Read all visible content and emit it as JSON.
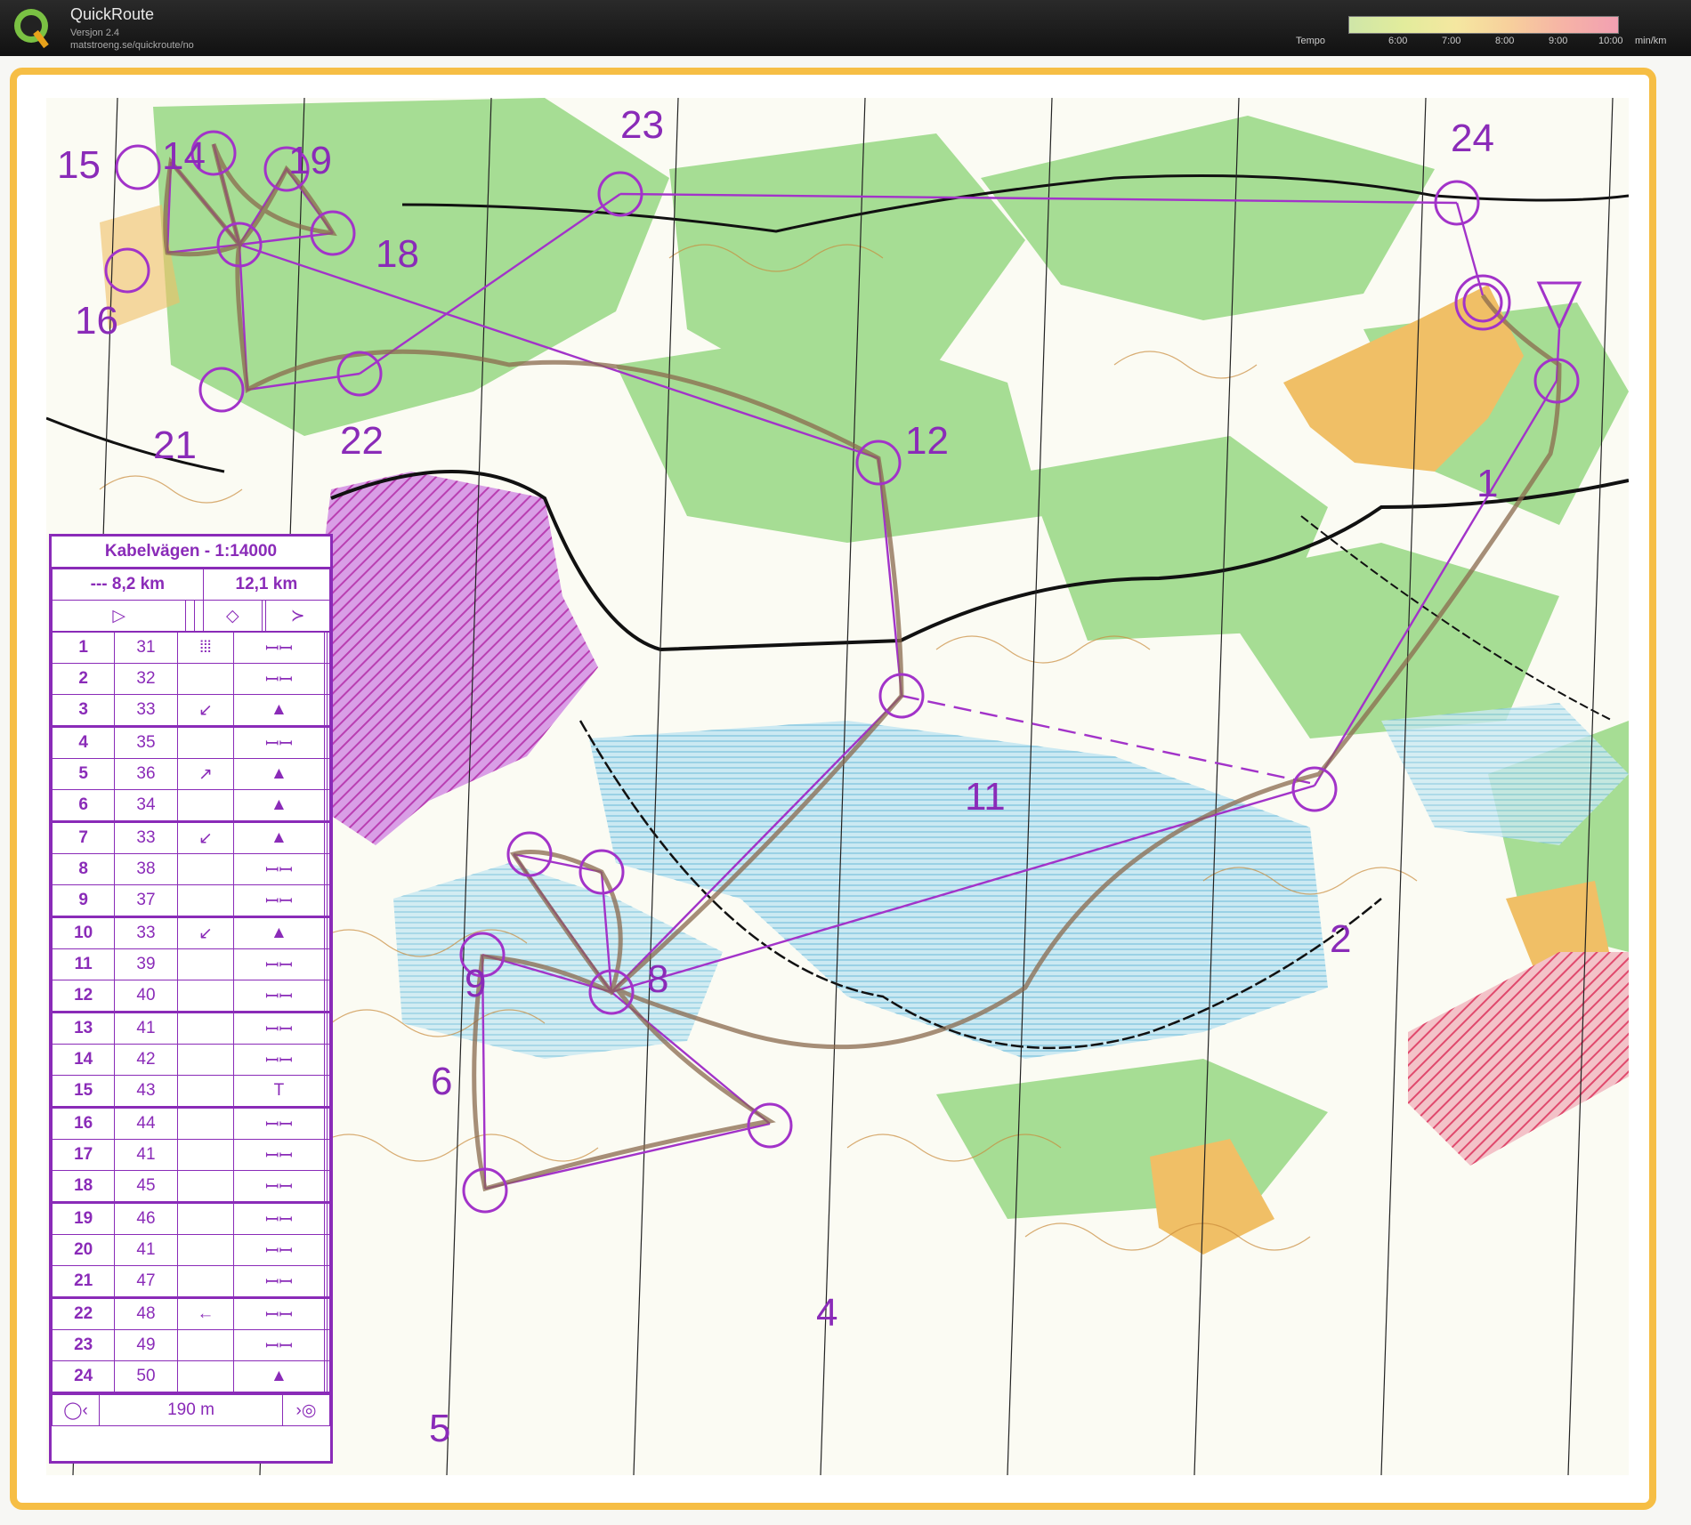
{
  "app": {
    "name": "QuickRoute",
    "version": "Versjon 2.4",
    "url": "matstroeng.se/quickroute/no"
  },
  "pace_legend": {
    "title": "Tempo",
    "unit": "min/km",
    "ticks": [
      "6:00",
      "7:00",
      "8:00",
      "9:00",
      "10:00"
    ]
  },
  "colors": {
    "course": "#a233c9",
    "frame": "#f6be45",
    "water": "#bfe3ec",
    "forest_green": "#9bd889",
    "open_land": "#f0bf66",
    "restricted": "#c86fd8"
  },
  "course": {
    "title": "Kabelvägen - 1:14000",
    "distance_short": "--- 8,2 km",
    "distance_long": "12,1 km",
    "finish_distance": "190 m",
    "rows": [
      {
        "n": "1",
        "code": "31",
        "c": "⦙⦙⦙",
        "d": "ꟷꟷ"
      },
      {
        "n": "2",
        "code": "32",
        "c": "",
        "d": "ꟷꟷ"
      },
      {
        "n": "3",
        "code": "33",
        "c": "↙",
        "d": "▲"
      },
      {
        "n": "4",
        "code": "35",
        "c": "",
        "d": "ꟷꟷ"
      },
      {
        "n": "5",
        "code": "36",
        "c": "↗",
        "d": "▲"
      },
      {
        "n": "6",
        "code": "34",
        "c": "",
        "d": "▲"
      },
      {
        "n": "7",
        "code": "33",
        "c": "↙",
        "d": "▲"
      },
      {
        "n": "8",
        "code": "38",
        "c": "",
        "d": "ꟷꟷ"
      },
      {
        "n": "9",
        "code": "37",
        "c": "",
        "d": "ꟷꟷ"
      },
      {
        "n": "10",
        "code": "33",
        "c": "↙",
        "d": "▲"
      },
      {
        "n": "11",
        "code": "39",
        "c": "",
        "d": "ꟷꟷ"
      },
      {
        "n": "12",
        "code": "40",
        "c": "",
        "d": "ꟷꟷ"
      },
      {
        "n": "13",
        "code": "41",
        "c": "",
        "d": "ꟷꟷ"
      },
      {
        "n": "14",
        "code": "42",
        "c": "",
        "d": "ꟷꟷ"
      },
      {
        "n": "15",
        "code": "43",
        "c": "",
        "d": "T"
      },
      {
        "n": "16",
        "code": "44",
        "c": "",
        "d": "ꟷꟷ"
      },
      {
        "n": "17",
        "code": "41",
        "c": "",
        "d": "ꟷꟷ"
      },
      {
        "n": "18",
        "code": "45",
        "c": "",
        "d": "ꟷꟷ"
      },
      {
        "n": "19",
        "code": "46",
        "c": "",
        "d": "ꟷꟷ"
      },
      {
        "n": "20",
        "code": "41",
        "c": "",
        "d": "ꟷꟷ"
      },
      {
        "n": "21",
        "code": "47",
        "c": "",
        "d": "ꟷꟷ"
      },
      {
        "n": "22",
        "code": "48",
        "c": "←",
        "d": "ꟷꟷ"
      },
      {
        "n": "23",
        "code": "49",
        "c": "",
        "d": "ꟷꟷ"
      },
      {
        "n": "24",
        "code": "50",
        "c": "",
        "d": "▲"
      }
    ]
  },
  "control_labels": [
    "1",
    "2",
    "4",
    "5",
    "6",
    "8",
    "9",
    "11",
    "12",
    "14",
    "15",
    "16",
    "18",
    "19",
    "21",
    "22",
    "23",
    "24"
  ]
}
